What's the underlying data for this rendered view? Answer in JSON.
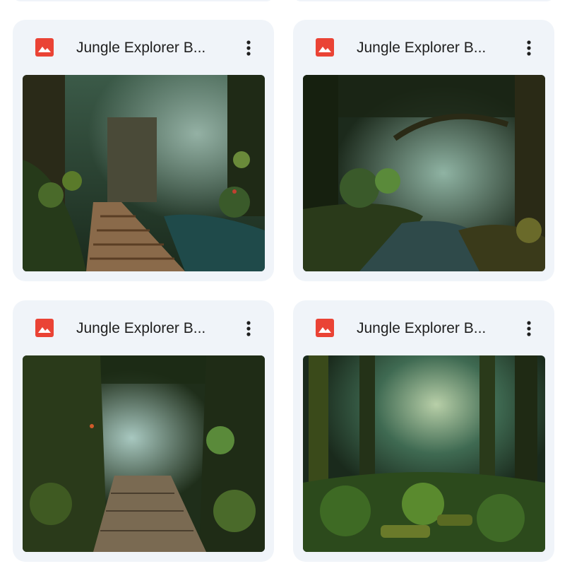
{
  "colors": {
    "card_background": "#f0f4f9",
    "title_text": "#1f1f1f",
    "image_icon": "#ea4335"
  },
  "files": [
    {
      "title": "Jungle Explorer B...",
      "icon": "image-file-icon",
      "menu_icon": "more-vert-icon",
      "thumbnail": "jungle-stone-stairway-ruins"
    },
    {
      "title": "Jungle Explorer B...",
      "icon": "image-file-icon",
      "menu_icon": "more-vert-icon",
      "thumbnail": "jungle-river-misty-canopy"
    },
    {
      "title": "Jungle Explorer B...",
      "icon": "image-file-icon",
      "menu_icon": "more-vert-icon",
      "thumbnail": "jungle-stone-path-tunnel"
    },
    {
      "title": "Jungle Explorer B...",
      "icon": "image-file-icon",
      "menu_icon": "more-vert-icon",
      "thumbnail": "jungle-fern-forest-floor"
    }
  ]
}
